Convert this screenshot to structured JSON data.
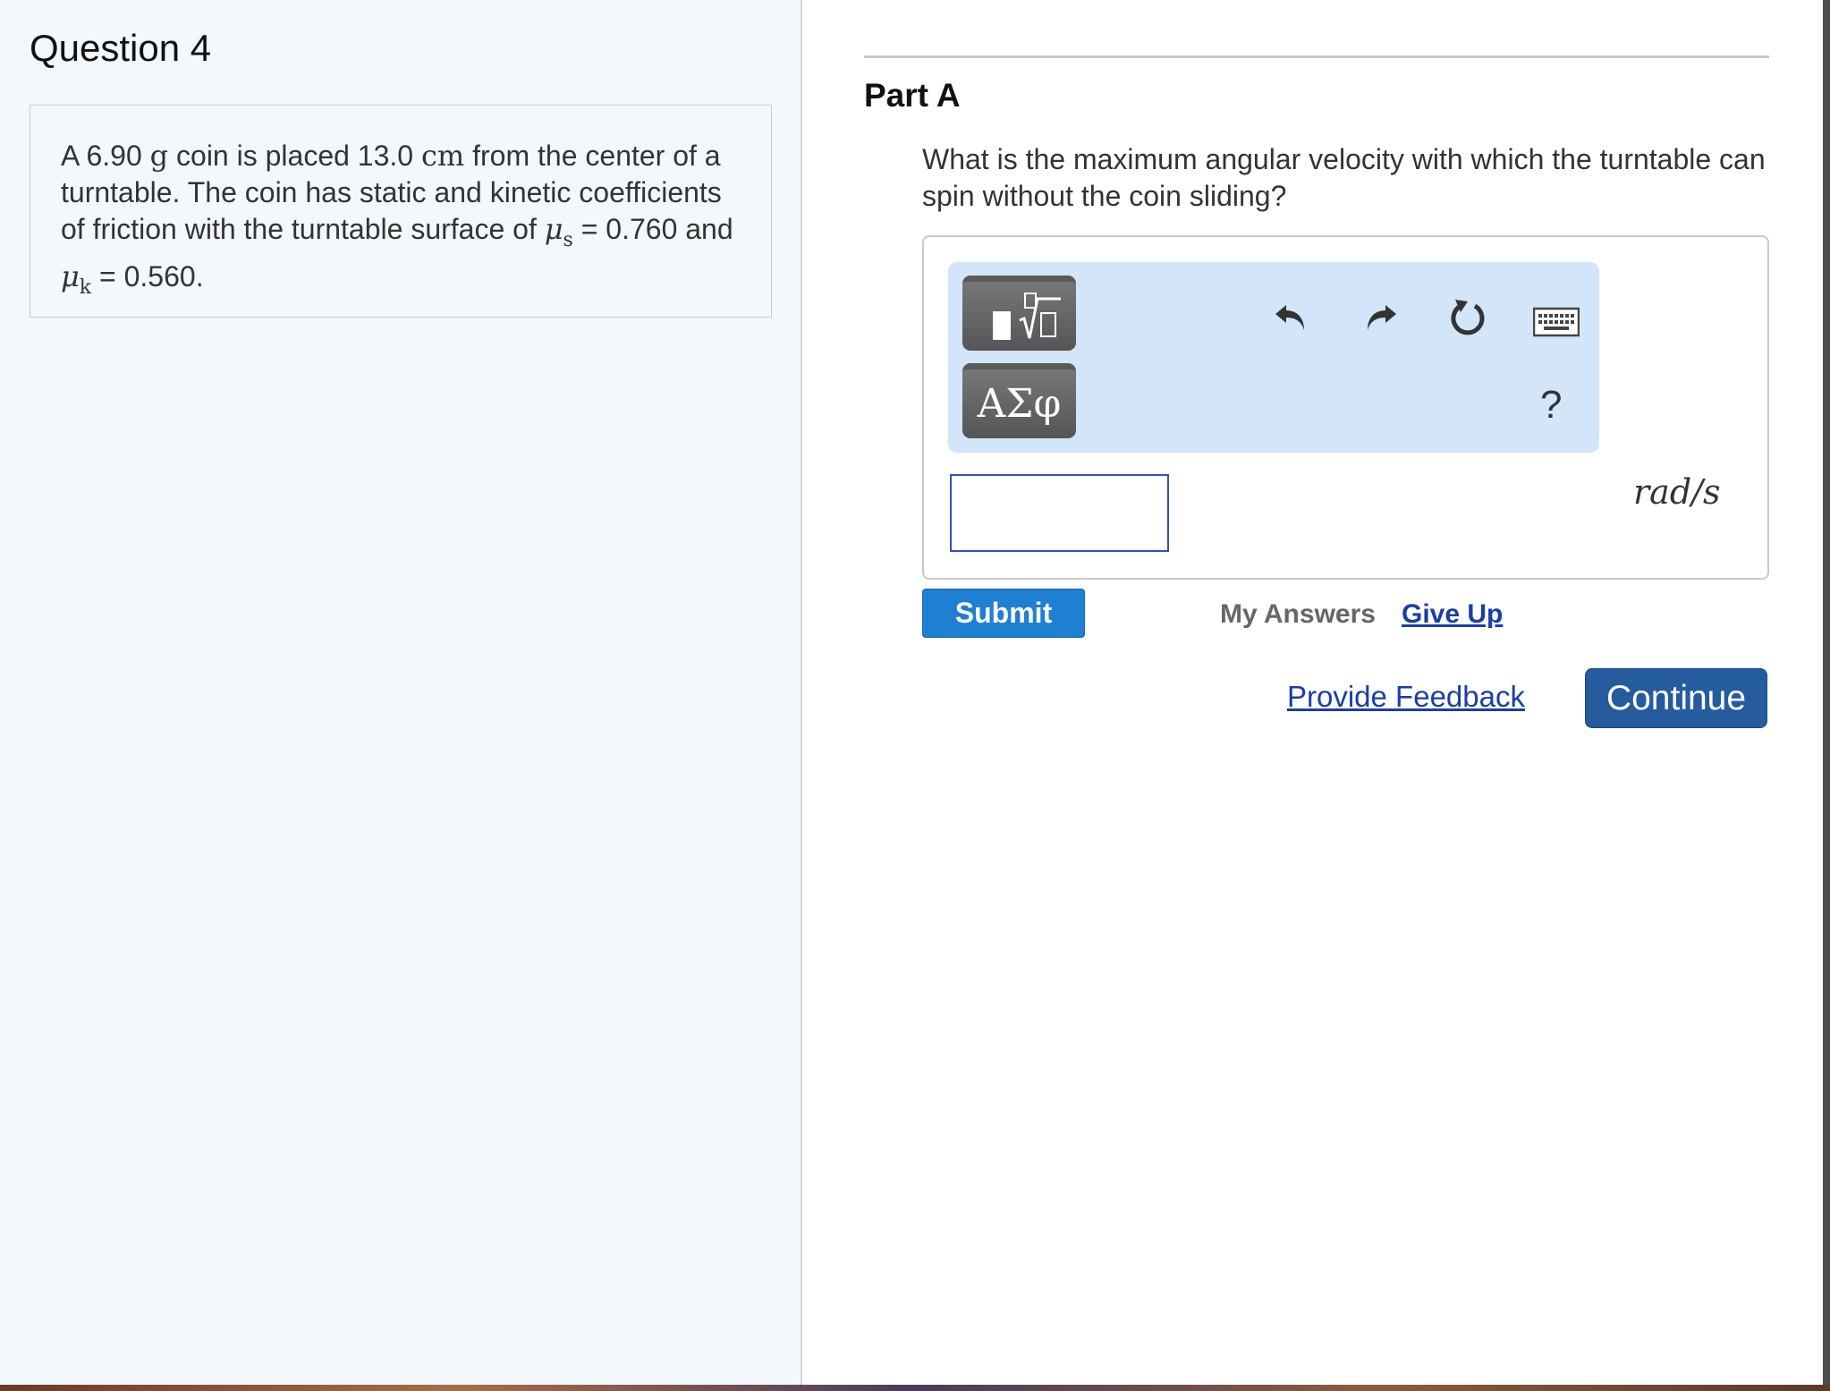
{
  "question": {
    "title": "Question 4",
    "problem": {
      "text_1": "A 6.90 ",
      "mass_unit": "g",
      "text_2": " coin is placed 13.0 ",
      "dist_unit": "cm",
      "text_3": " from the center of a turntable. The coin has static and kinetic coefficients of friction with the turntable surface of ",
      "mu_symbol": "μ",
      "mu_s_sub": "s",
      "mu_s_value": " = 0.760 and ",
      "mu_k_sub": "k",
      "mu_k_value": " = 0.560."
    }
  },
  "part": {
    "title": "Part A",
    "question_text": "What is the maximum angular velocity with which the turntable can spin without the coin sliding?"
  },
  "toolbar": {
    "symbols_label": "ΑΣφ",
    "help_label": "?"
  },
  "answer": {
    "value": "",
    "unit": "rad/s"
  },
  "actions": {
    "submit_label": "Submit",
    "my_answers_label": "My Answers",
    "give_up_label": "Give Up",
    "provide_feedback_label": "Provide Feedback",
    "continue_label": "Continue"
  },
  "colors": {
    "submit": "#1f7fd1",
    "continue": "#245c9e",
    "link": "#1a3ea8",
    "toolbar_bg": "#d2e5f9",
    "left_panel_bg": "#f3f8fd"
  }
}
